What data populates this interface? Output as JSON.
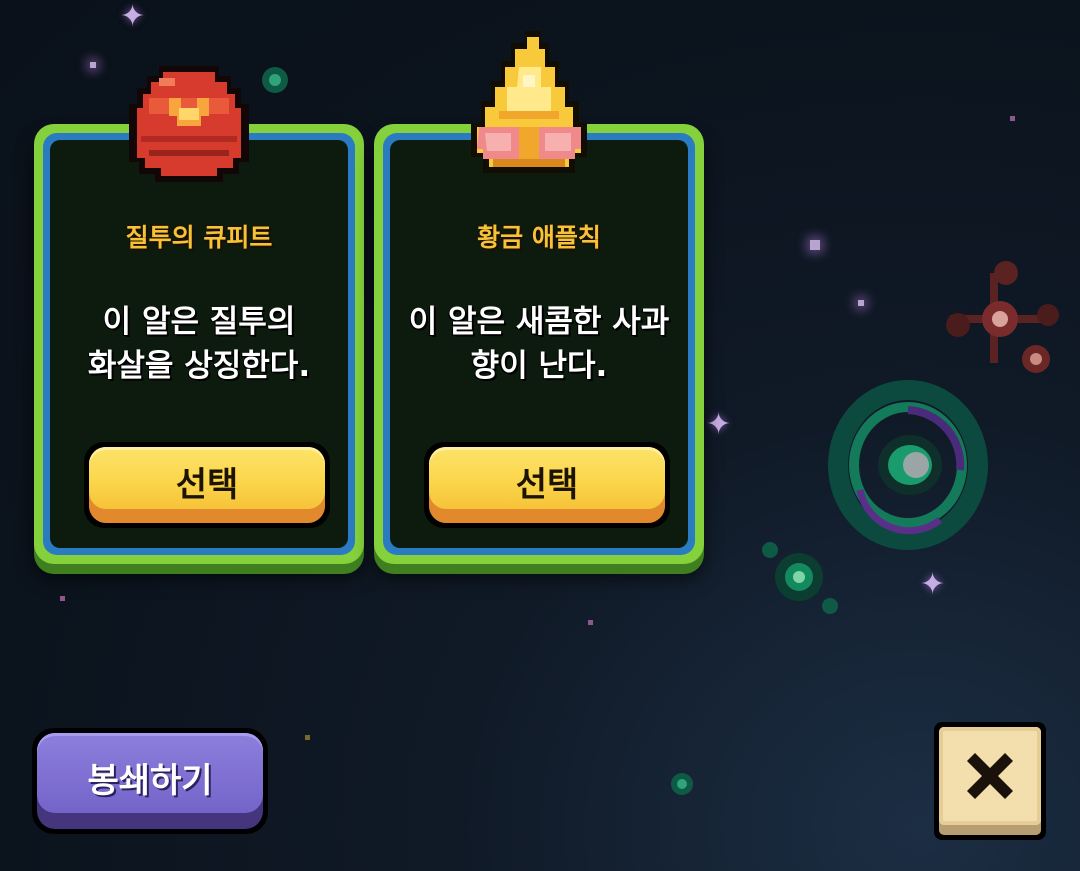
{
  "cards": [
    {
      "name": "질투의 큐피트",
      "desc_line1": "이 알은 질투의",
      "desc_line2": "화살을 상징한다.",
      "button_label": "선택",
      "icon": "red-egg-icon"
    },
    {
      "name": "황금 애플칙",
      "desc_line1": "이 알은 새콤한 사과",
      "desc_line2": "향이 난다.",
      "button_label": "선택",
      "icon": "golden-egg-icon"
    }
  ],
  "seal_button": {
    "label": "봉쇄하기"
  },
  "close_button": {
    "icon": "close-icon"
  },
  "colors": {
    "card_border": "#84d13b",
    "card_inner_border": "#2a7bc2",
    "name_text": "#f6c338",
    "select_button": "#fbd64b",
    "seal_button": "#7464c9",
    "close_button": "#f3dfae"
  }
}
